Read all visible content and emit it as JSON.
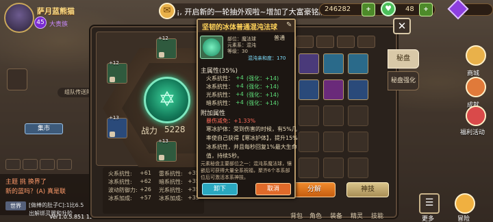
{
  "player": {
    "name": "萨月蓝熊猫",
    "level": "45",
    "title": "大贵族"
  },
  "announcement": "¡, 开启新的一轮抽外观啦~增加了大富豪铭牌",
  "resources": {
    "gold": "246282",
    "hp": "48",
    "plus": "+"
  },
  "left": {
    "team_label": "组队传送阵",
    "market_label": "集市",
    "chat_line1": "主题 挑 换界了",
    "chat_line2": "新的蓝吗？(A) 真是联",
    "world_tag": "世界",
    "chat_line3": "[做棒的肚子C]:1比6.5",
    "chat_line4": "出解绑灵翼和升阶",
    "version": "Ver1.0.5.851 1286061136289.33"
  },
  "close": "✕",
  "tabs": [
    "秘盘",
    "秘盘强化"
  ],
  "panel": {
    "power_label": "战力",
    "power_value": "5228",
    "slots": [
      {
        "level": "+12"
      },
      {
        "level": "+12"
      },
      {
        "level": "+13"
      },
      {
        "level": "+13"
      }
    ],
    "stats": [
      {
        "label": "火系抗性:",
        "value": "+61"
      },
      {
        "label": "冰系抗性:",
        "value": "+62"
      },
      {
        "label": "波动防御力:",
        "value": "+26"
      },
      {
        "label": "冰系加成:",
        "value": "+57"
      }
    ],
    "stats_right": [
      {
        "label": "雷系抗性:",
        "value": "+35"
      },
      {
        "label": "暗系抗性:",
        "value": "+35"
      },
      {
        "label": "光系抗性:",
        "value": "+35"
      },
      {
        "label": "冰系加成:",
        "value": "+35"
      }
    ]
  },
  "buttons": {
    "decompose": "分解",
    "skill": "神技"
  },
  "side": {
    "shop": "商城",
    "achievement": "成就",
    "welfare": "福利活动"
  },
  "nav": [
    "背包",
    "角色",
    "装备",
    "精灵",
    "技能"
  ],
  "more": "更多",
  "adventure": "冒险",
  "tooltip": {
    "title": "坚韧的冰体普通混沌法球",
    "quality": "普通",
    "slot": "部位：魔法球",
    "element": "元素系：混沌",
    "level": "等级：30",
    "affinity": "混沌亲和度：170",
    "main_header": "主属性(35%)",
    "main_stats": [
      {
        "name": "火系抗性：",
        "base": "+4",
        "bonus": "(强化：+14)"
      },
      {
        "name": "冰系抗性：",
        "base": "+4",
        "bonus": "(强化：+14)"
      },
      {
        "name": "光系抗性：",
        "base": "+4",
        "bonus": "(强化：+14)"
      },
      {
        "name": "暗系抗性：",
        "base": "+4",
        "bonus": "(强化：+14)"
      }
    ],
    "sub_header": "附加属性",
    "sub_stat": "暴伤减免：+1.33%",
    "desc1": "寒冰护体：受到伤害的时候，有5%几率使自己获得【寒冰护体】，提升15%冰系抗性，并且每秒回复1%最大生命值，持续5秒。",
    "desc2": "元素秘盘主要部位之一：混沌系魔法球，镶嵌后可获得大量全系祝福，聚齐6个本系部位后可激活本系神技。",
    "unequip": "卸下",
    "replace": "取消"
  },
  "colors": {
    "gold": "#ffd35a",
    "green": "#5ee07a",
    "blue": "#7fe0ff"
  }
}
